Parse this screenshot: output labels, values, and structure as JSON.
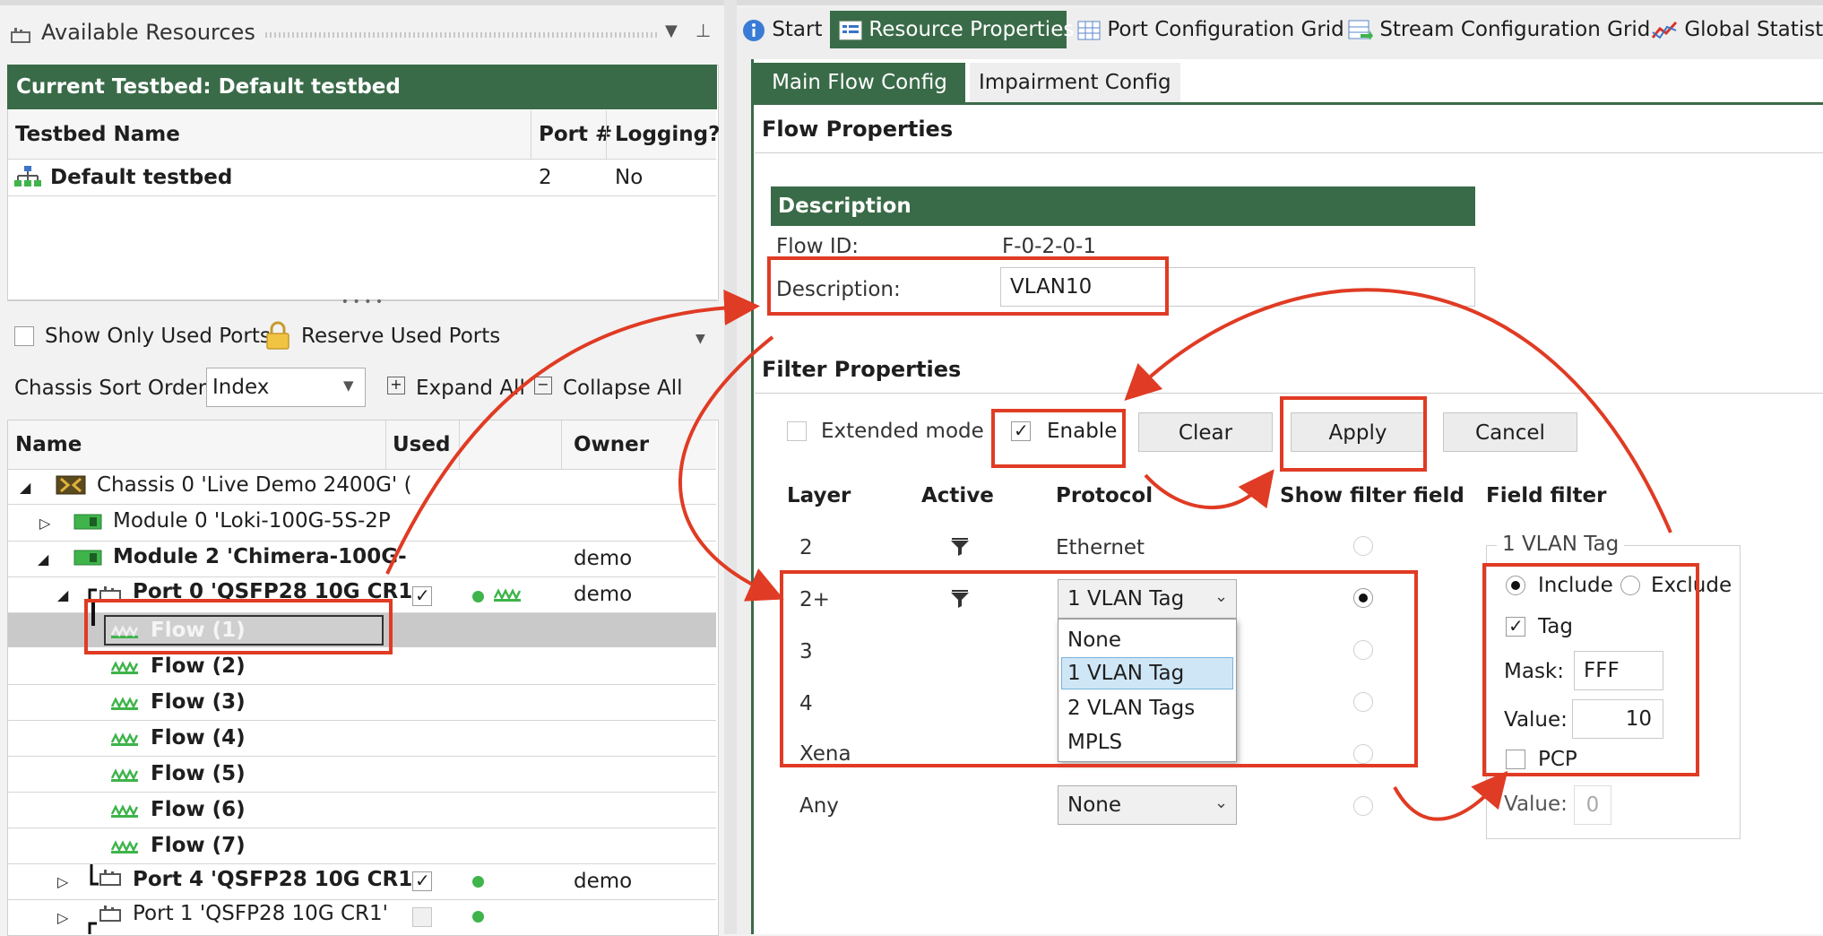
{
  "left": {
    "panel_title": "Available Resources",
    "testbed_header": "Current Testbed: Default testbed",
    "columns": {
      "name": "Testbed Name",
      "port": "Port #",
      "logging": "Logging?"
    },
    "testbed_row": {
      "name": "Default testbed",
      "port": "2",
      "logging": "No"
    },
    "show_only_used": "Show Only Used Ports",
    "reserve_used": "Reserve Used Ports",
    "sort_label": "Chassis Sort Order:",
    "sort_value": "Index",
    "expand_all": "Expand All",
    "collapse_all": "Collapse All",
    "tree_cols": {
      "name": "Name",
      "used": "Used",
      "owner": "Owner"
    },
    "tree": {
      "chassis": "Chassis 0 'Live Demo 2400G' (",
      "module0": "Module 0 'Loki-100G-5S-2P",
      "module2": "Module 2 'Chimera-100G-",
      "module2_owner": "demo",
      "port0": "Port 0 'QSFP28 10G CR1",
      "port0_owner": "demo",
      "flows": [
        "Flow (1)",
        "Flow (2)",
        "Flow (3)",
        "Flow (4)",
        "Flow (5)",
        "Flow (6)",
        "Flow (7)"
      ],
      "port4": "Port 4 'QSFP28 10G CR1",
      "port4_owner": "demo",
      "port1": "Port 1 'QSFP28 10G CR1'"
    }
  },
  "tabs": [
    "Start",
    "Resource Properties",
    "Port Configuration Grid",
    "Stream Configuration Grid",
    "Global Statistic"
  ],
  "subtabs": {
    "main": "Main Flow Config",
    "impairment": "Impairment Config"
  },
  "flow": {
    "section_title": "Flow Properties",
    "desc_header": "Description",
    "flow_id_label": "Flow ID:",
    "flow_id": "F-0-2-0-1",
    "desc_label": "Description:",
    "desc_value": "VLAN10"
  },
  "filter": {
    "section_title": "Filter Properties",
    "extended_mode": "Extended mode",
    "enable": "Enable",
    "clear": "Clear",
    "apply": "Apply",
    "cancel": "Cancel",
    "cols": {
      "layer": "Layer",
      "active": "Active",
      "protocol": "Protocol",
      "show": "Show filter field",
      "field": "Field filter"
    },
    "layers": [
      "2",
      "2+",
      "3",
      "4",
      "Xena",
      "Any"
    ],
    "ethernet": "Ethernet",
    "protocol_2plus": "1 VLAN Tag",
    "protocol_any": "None",
    "dropdown_options": [
      "None",
      "1 VLAN Tag",
      "2 VLAN Tags",
      "MPLS"
    ],
    "field_group": "1 VLAN Tag",
    "include": "Include",
    "exclude": "Exclude",
    "tag": "Tag",
    "mask_label": "Mask:",
    "mask_value": "FFF",
    "value_label": "Value:",
    "value": "10",
    "pcp": "PCP",
    "pcp_value_label": "Value:",
    "pcp_value": "0"
  },
  "colors": {
    "header_green": "#3a6b48",
    "highlight": "#e03b24",
    "selection": "#cfe6f7"
  }
}
